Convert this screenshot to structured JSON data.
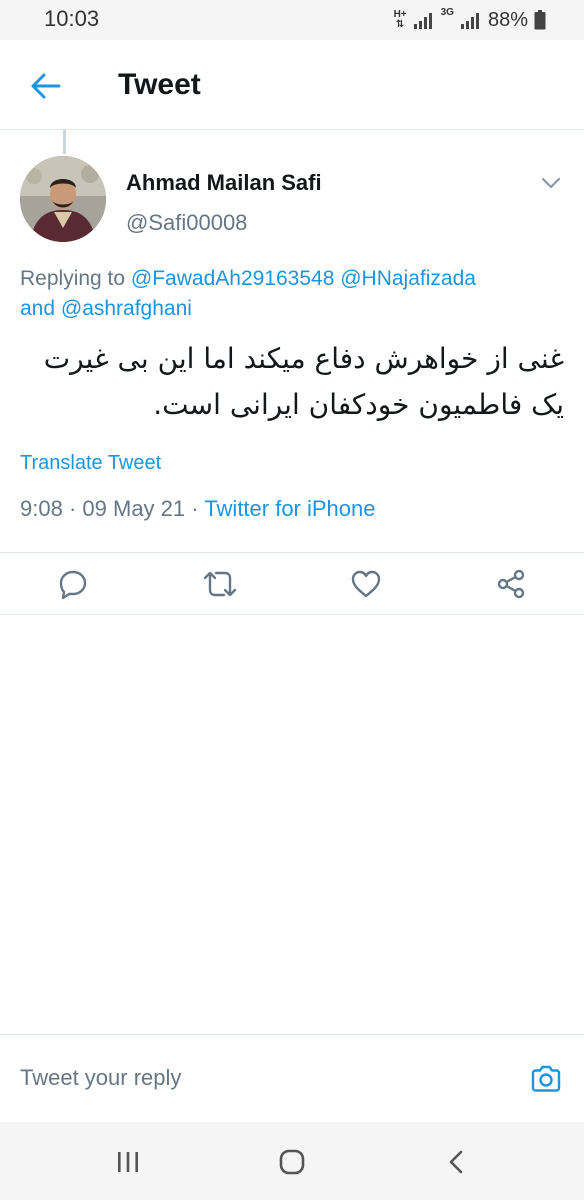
{
  "status_bar": {
    "time": "10:03",
    "network_1": "H+",
    "network_2": "3G",
    "battery": "88%"
  },
  "header": {
    "title": "Tweet",
    "back_icon": "arrow-left-icon"
  },
  "tweet": {
    "author_name": "Ahmad Mailan Safi",
    "author_handle": "@Safi00008",
    "replying_prefix": "Replying to ",
    "mention_1": "@FawadAh29163548",
    "mention_2": "@HNajafizada",
    "and_text": "and ",
    "mention_3": "@ashrafghani",
    "text": "غنی از خواهرش دفاع میکند اما این بی غیرت یک فاطمیون خودکفان ایرانی است.",
    "translate_label": "Translate Tweet",
    "time": "9:08",
    "date": "09 May 21",
    "separator": "·",
    "source": "Twitter for iPhone"
  },
  "actions": [
    "reply-icon",
    "retweet-icon",
    "like-icon",
    "share-icon"
  ],
  "reply_bar": {
    "placeholder": "Tweet your reply"
  },
  "colors": {
    "accent": "#1b95e0",
    "secondary_text": "#657786",
    "divider": "#e1e8ed"
  }
}
